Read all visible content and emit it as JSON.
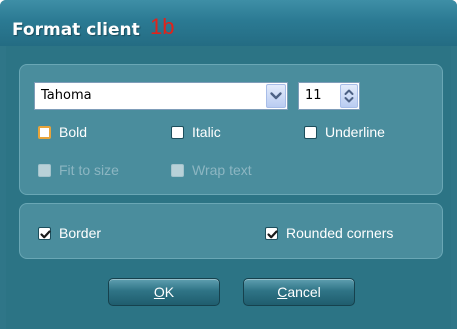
{
  "window": {
    "title": "Format client",
    "badge": "1b"
  },
  "font": {
    "family_selected": "Tahoma",
    "size_value": "11"
  },
  "style_options": {
    "bold_label": "Bold",
    "italic_label": "Italic",
    "underline_label": "Underline",
    "fit_to_size_label": "Fit to size",
    "wrap_text_label": "Wrap text",
    "bold_checked": false,
    "italic_checked": false,
    "underline_checked": false,
    "fit_to_size_checked": false,
    "wrap_text_checked": false,
    "fit_to_size_enabled": false,
    "wrap_text_enabled": false
  },
  "border_options": {
    "border_label": "Border",
    "rounded_corners_label": "Rounded corners",
    "border_checked": true,
    "rounded_corners_checked": true
  },
  "buttons": {
    "ok_mnemonic": "O",
    "ok_rest": "K",
    "cancel_mnemonic": "C",
    "cancel_rest": "ancel"
  },
  "colors": {
    "accent_title": "#2b7a93",
    "badge": "#e0231b",
    "focus_box": "#e8a43a"
  },
  "icons": {
    "dropdown": "chevron-down-icon",
    "spinner": "up-down-arrows-icon",
    "check": "checkmark-icon"
  }
}
